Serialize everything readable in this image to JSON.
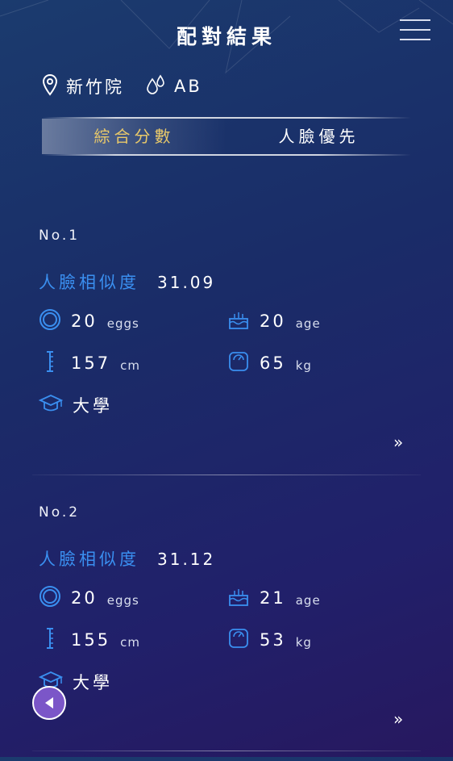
{
  "header": {
    "title": "配對結果"
  },
  "info": {
    "location": "新竹院",
    "blood_type": "AB"
  },
  "tabs": [
    {
      "label": "綜合分數",
      "active": true
    },
    {
      "label": "人臉優先",
      "active": false
    }
  ],
  "colors": {
    "accent_tab": "#e8c86a",
    "similarity": "#3a8ff0",
    "icon": "#3a8ff0"
  },
  "results": [
    {
      "rank": "No.1",
      "similarity_label": "人臉相似度",
      "similarity_value": "31.09",
      "eggs": "20",
      "eggs_unit": "eggs",
      "age": "20",
      "age_unit": "age",
      "height": "157",
      "height_unit": "cm",
      "weight": "65",
      "weight_unit": "kg",
      "education": "大學",
      "more": "»"
    },
    {
      "rank": "No.2",
      "similarity_label": "人臉相似度",
      "similarity_value": "31.12",
      "eggs": "20",
      "eggs_unit": "eggs",
      "age": "21",
      "age_unit": "age",
      "height": "155",
      "height_unit": "cm",
      "weight": "53",
      "weight_unit": "kg",
      "education": "大學",
      "more": "»"
    }
  ]
}
